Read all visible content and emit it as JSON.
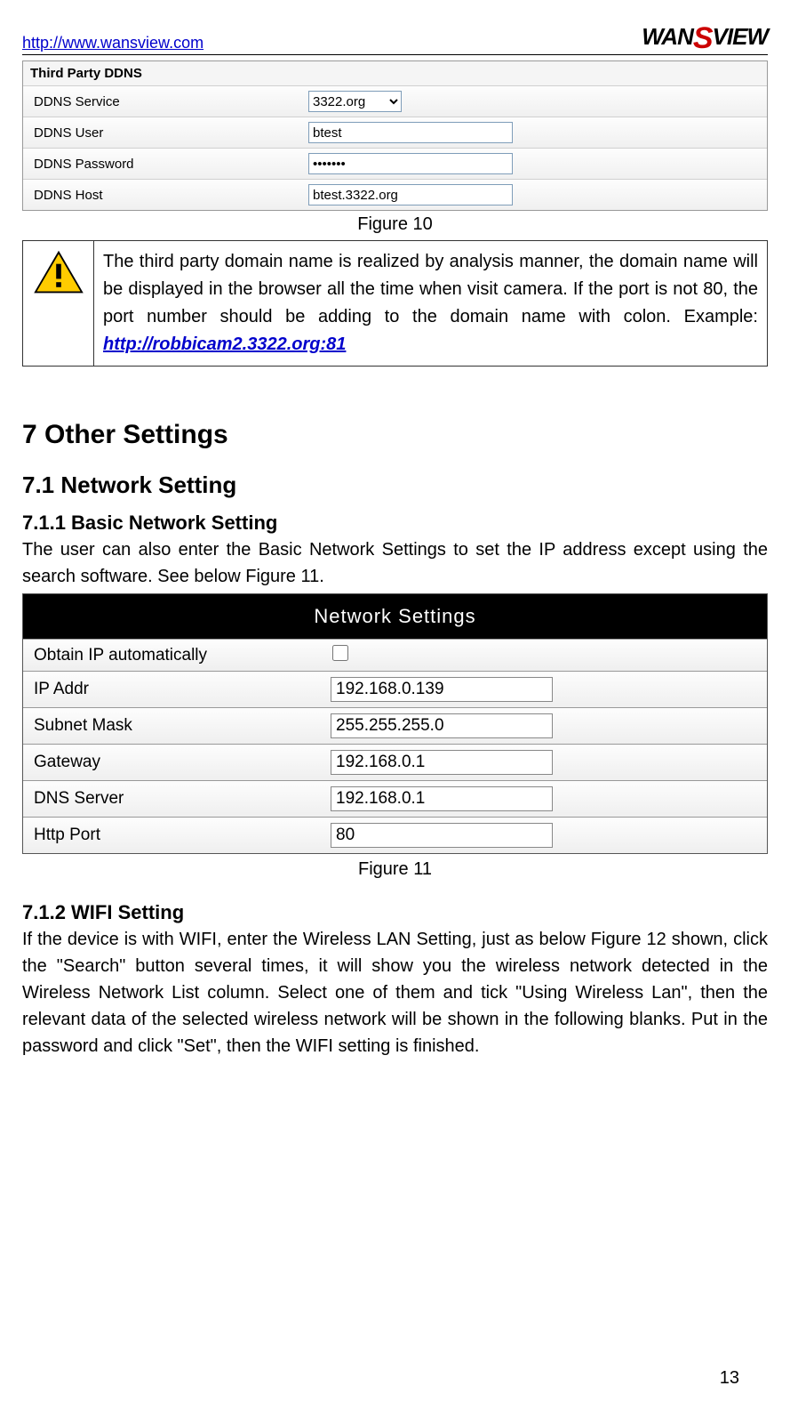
{
  "header": {
    "url": "http://www.wansview.com",
    "logo_pre": "WAN",
    "logo_s": "S",
    "logo_post": "VIEW"
  },
  "ddns_panel": {
    "title": "Third Party DDNS",
    "rows": [
      {
        "label": "DDNS Service",
        "type": "select",
        "value": "3322.org"
      },
      {
        "label": "DDNS User",
        "type": "text",
        "value": "btest"
      },
      {
        "label": "DDNS Password",
        "type": "password",
        "value": "•••••••"
      },
      {
        "label": "DDNS Host",
        "type": "text",
        "value": "btest.3322.org"
      }
    ]
  },
  "figure10_caption": "Figure 10",
  "warning": {
    "text_pre": "The third party domain name is realized by analysis manner, the domain name will be displayed in the browser all the time when visit camera. If the port is not 80, the port number should be adding to the domain name with colon. Example: ",
    "example_link": "http://robbicam2.3322.org:81"
  },
  "section7": {
    "heading": "7  Other Settings",
    "sub1": "7.1  Network Setting",
    "sub1_1": "7.1.1  Basic Network Setting",
    "body1": "The user can also enter the Basic Network Settings to set the IP address except using the search software. See below Figure 11."
  },
  "net_panel": {
    "title": "Network Settings",
    "rows": [
      {
        "label": "Obtain IP automatically",
        "type": "checkbox",
        "value": ""
      },
      {
        "label": "IP Addr",
        "type": "text",
        "value": "192.168.0.139"
      },
      {
        "label": "Subnet Mask",
        "type": "text",
        "value": "255.255.255.0"
      },
      {
        "label": "Gateway",
        "type": "text",
        "value": "192.168.0.1"
      },
      {
        "label": "DNS Server",
        "type": "text",
        "value": "192.168.0.1"
      },
      {
        "label": "Http Port",
        "type": "text",
        "value": "80"
      }
    ]
  },
  "figure11_caption": "Figure 11",
  "section712": {
    "heading": "7.1.2  WIFI Setting",
    "body": "If the device is with WIFI, enter the Wireless LAN Setting, just as below Figure 12 shown, click the \"Search\" button several times, it will show you the wireless network detected in the Wireless Network List column. Select one of them and tick \"Using Wireless Lan\", then the relevant data of the selected wireless network will be shown in the following blanks. Put in the password and click \"Set\", then the WIFI setting is finished."
  },
  "page_number": "13"
}
